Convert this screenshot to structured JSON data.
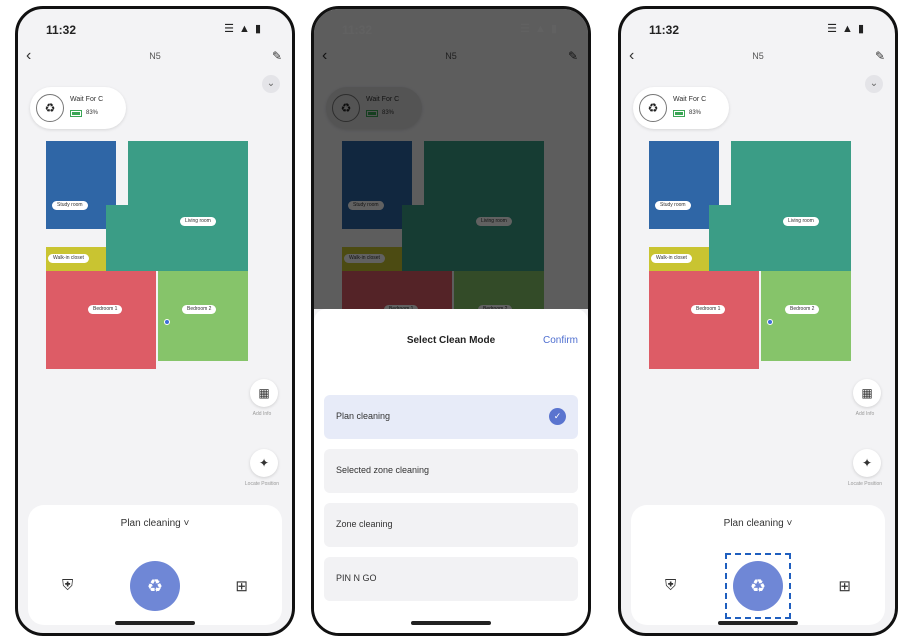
{
  "status": {
    "time": "11:32",
    "signal_icons": "☰ ▲ ▮"
  },
  "nav": {
    "title": "N5"
  },
  "device": {
    "name": "Wait For C",
    "battery": "83%",
    "battery_level": 0.83
  },
  "map": {
    "rooms": [
      {
        "label": "Study room",
        "color": "#2f66a6"
      },
      {
        "label": "Living room",
        "color": "#3b9d86"
      },
      {
        "label": "Walk-in closet",
        "color": "#c9c431"
      },
      {
        "label": "Bedroom 1",
        "color": "#dd5c66"
      },
      {
        "label": "Bedroom 2",
        "color": "#86c46a"
      }
    ]
  },
  "side": {
    "map_caption": "Add Info",
    "locate_caption": "Locate Position"
  },
  "panel": {
    "mode": "Plan cleaning",
    "mode_chevron": "˅"
  },
  "sheet": {
    "title": "Select Clean Mode",
    "confirm": "Confirm",
    "options": [
      {
        "label": "Plan cleaning",
        "selected": true
      },
      {
        "label": "Selected zone cleaning",
        "selected": false
      },
      {
        "label": "Zone cleaning",
        "selected": false
      },
      {
        "label": "PIN N GO",
        "selected": false
      }
    ]
  },
  "colors": {
    "accent": "#6f87d6",
    "confirm": "#4f6fd0",
    "focus": "#1f5fbf"
  }
}
